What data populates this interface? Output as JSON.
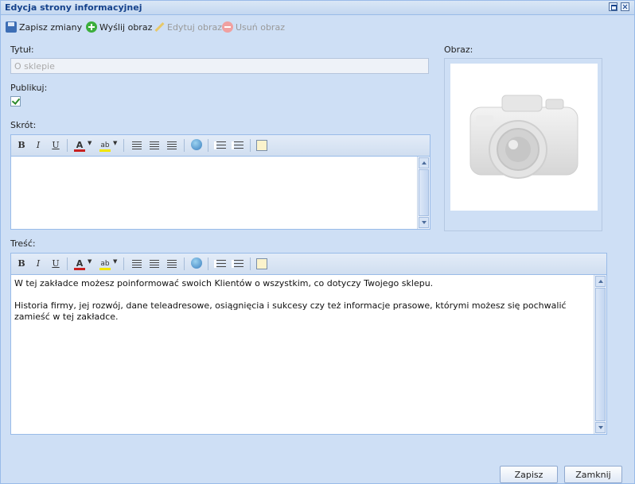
{
  "window": {
    "title": "Edycja strony informacyjnej"
  },
  "toolbar": {
    "save_label": "Zapisz zmiany",
    "upload_label": "Wyślij obraz",
    "edit_label": "Edytuj obraz",
    "delete_label": "Usuń obraz"
  },
  "form": {
    "title_label": "Tytuł:",
    "title_value": "O sklepie",
    "publish_label": "Publikuj:",
    "publish_checked": true,
    "summary_label": "Skrót:",
    "content_label": "Treść:",
    "image_label": "Obraz:"
  },
  "editor_tools": {
    "bold": "B",
    "italic": "I",
    "underline": "U",
    "highlight": "ab"
  },
  "content": {
    "paragraphs": [
      "W tej zakładce możesz poinformować swoich Klientów o wszystkim, co dotyczy Twojego sklepu.",
      "Historia firmy, jej rozwój, dane teleadresowe, osiągnięcia i sukcesy czy też informacje prasowe, którymi możesz się pochwalić zamieść w tej zakładce."
    ]
  },
  "footer": {
    "save_label": "Zapisz",
    "close_label": "Zamknij"
  }
}
